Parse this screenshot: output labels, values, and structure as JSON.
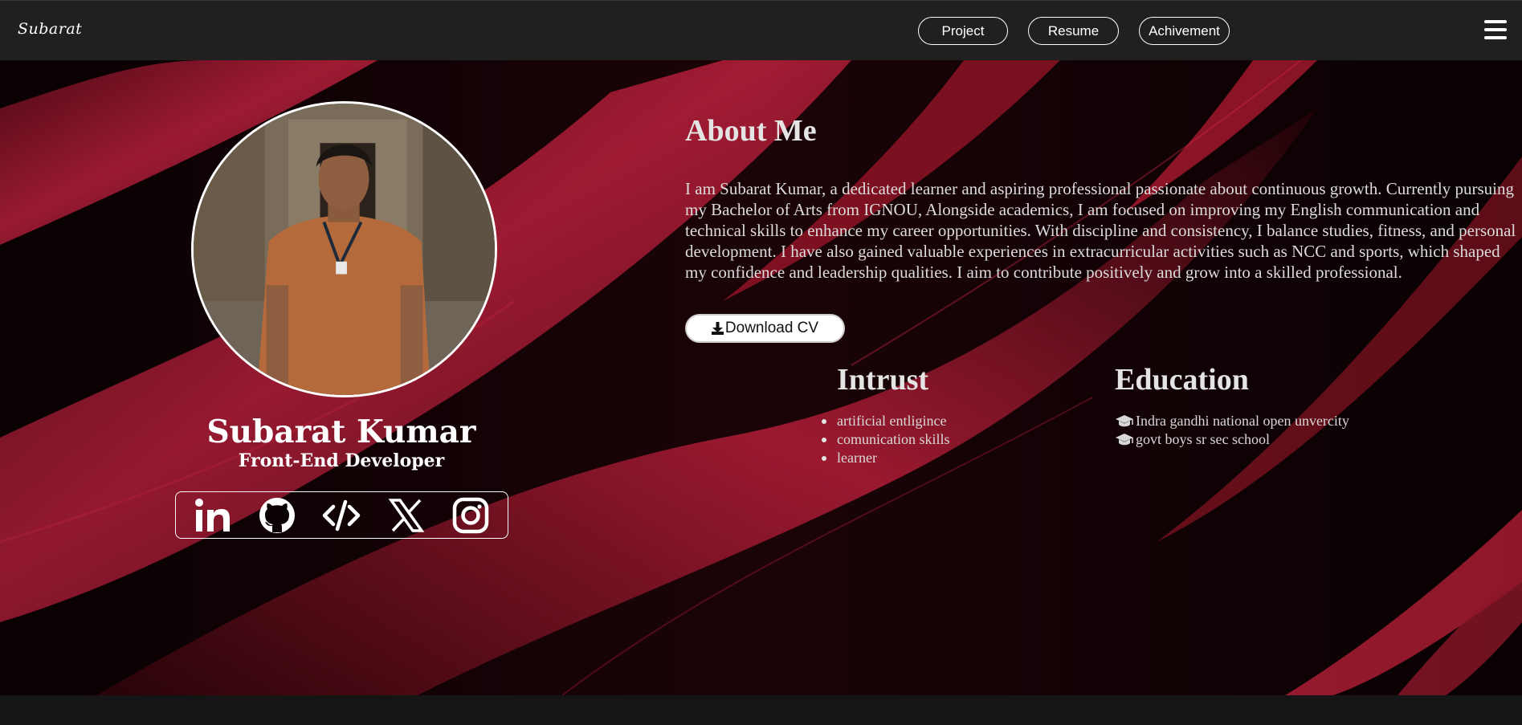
{
  "nav": {
    "brand": "Subarat",
    "links": [
      "Project",
      "Resume",
      "Achivement"
    ],
    "menu_icon": "hamburger-icon"
  },
  "profile": {
    "name": "Subarat Kumar",
    "role": "Front-End Developer",
    "photo": "profile-photo",
    "socials": [
      "linkedin-icon",
      "github-icon",
      "code-icon",
      "x-icon",
      "instagram-icon"
    ]
  },
  "about": {
    "title": "About Me",
    "text": "I am Subarat Kumar, a dedicated learner and aspiring professional passionate about continuous growth. Currently pursuing my Bachelor of Arts from IGNOU, Alongside academics, I am focused on improving my English communication and technical skills to enhance my career opportunities. With discipline and consistency, I balance studies, fitness, and personal development. I have also gained valuable experiences in extracurricular activities such as NCC and sports, which shaped my confidence and leadership qualities. I aim to contribute positively and grow into a skilled professional.",
    "download_label": "Download CV",
    "download_icon": "download-icon"
  },
  "interest": {
    "title": "Intrust",
    "items": [
      "artificial entligince",
      "comunication skills",
      "learner"
    ]
  },
  "education": {
    "title": "Education",
    "icon": "graduation-cap-icon",
    "items": [
      "Indra gandhi national open unvercity",
      "govt boys sr sec school"
    ]
  },
  "colors": {
    "navbar": "#202020",
    "accent_red": "#b8203c",
    "background": "#070102",
    "text": "#ffffff"
  }
}
